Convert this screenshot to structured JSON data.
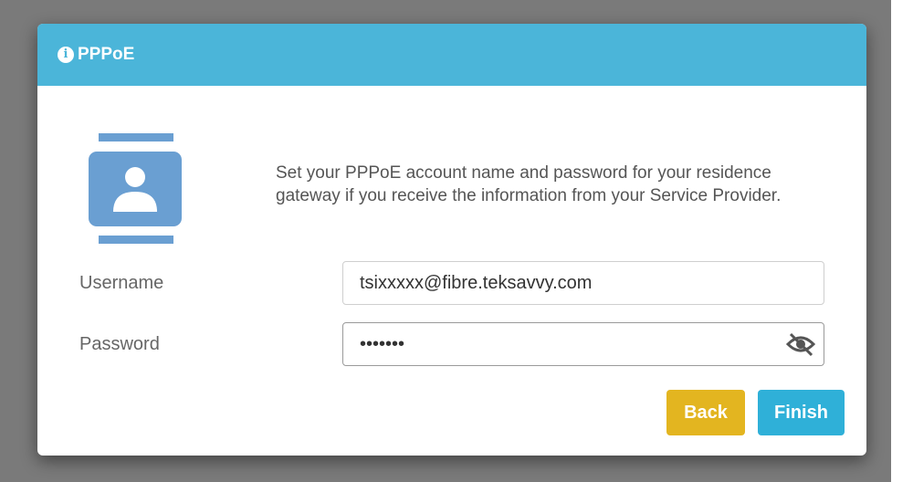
{
  "dialog": {
    "title": "PPPoE",
    "description": "Set your PPPoE account name and password for your residence gateway if you receive the information from your Service Provider."
  },
  "form": {
    "username_label": "Username",
    "username_value": "tsixxxxx@fibre.teksavvy.com",
    "password_label": "Password",
    "password_value": "•••••••"
  },
  "buttons": {
    "back_label": "Back",
    "finish_label": "Finish"
  },
  "icons": {
    "header": "info-icon",
    "account": "account-card-icon",
    "password_toggle": "eye-slash-icon"
  },
  "colors": {
    "header_bg": "#4bb5d9",
    "back_button": "#e3b520",
    "finish_button": "#2fb0d8",
    "account_icon": "#6a9fd2"
  }
}
